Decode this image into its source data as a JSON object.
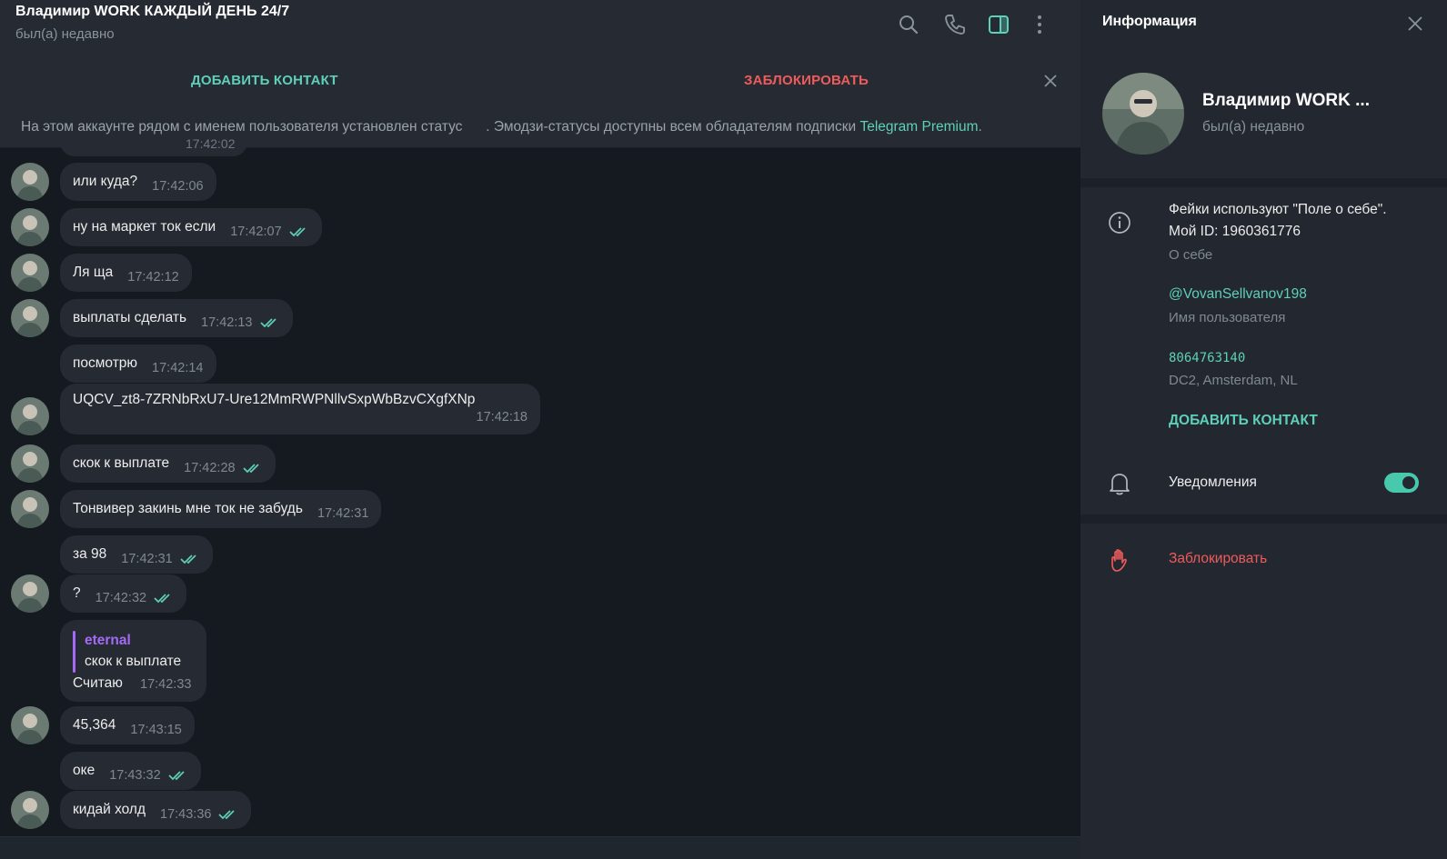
{
  "header": {
    "title": "Владимир WORK КАЖДЫЙ ДЕНЬ 24/7",
    "status": "был(а) недавно"
  },
  "action_bar": {
    "add_contact": "ДОБАВИТЬ КОНТАКТ",
    "block": "ЗАБЛОКИРОВАТЬ"
  },
  "notice": {
    "text_before": "На этом аккаунте рядом с именем пользователя установлен статус",
    "text_after": ". Эмодзи-статусы доступны всем обладателям подписки",
    "link": "Telegram Premium",
    "end": "."
  },
  "messages": [
    {
      "text": "или куда?",
      "time": "17:42:06"
    },
    {
      "text": "ну на маркет ток если",
      "time": "17:42:07"
    },
    {
      "text": "Ля ща",
      "time": "17:42:12"
    },
    {
      "text": "выплаты сделать",
      "time": "17:42:13"
    },
    {
      "text": "посмотрю",
      "time": "17:42:14"
    },
    {
      "text": "UQCV_zt8-7ZRNbRxU7-Ure12MmRWPNllvSxpWbBzvCXgfXNp",
      "time": "17:42:18"
    },
    {
      "text": "скок к выплате",
      "time": "17:42:28"
    },
    {
      "text": "Тонвивер закинь мне ток не забудь",
      "time": "17:42:31"
    },
    {
      "text": "за 98",
      "time": "17:42:31"
    },
    {
      "text": "?",
      "time": "17:42:32"
    },
    {
      "reply_name": "eternal",
      "reply_text": "скок к выплате",
      "text": "Считаю",
      "time": "17:42:33"
    },
    {
      "text": "45,364",
      "time": "17:43:15"
    },
    {
      "text": "оке",
      "time": "17:43:32"
    },
    {
      "text": "кидай холд",
      "time": "17:43:36"
    }
  ],
  "cut_message_time": "17:42:02",
  "panel": {
    "title": "Информация",
    "name": "Владимир WORK ...",
    "status": "был(а) недавно",
    "bio_line1": "Фейки используют \"Поле о себе\".",
    "bio_line2": "Мой ID: 1960361776",
    "bio_label": "О себе",
    "username": "@VovanSellvanov198",
    "username_label": "Имя пользователя",
    "id": "8064763140",
    "dc": "DC2, Amsterdam, NL",
    "add_contact": "ДОБАВИТЬ КОНТАКТ",
    "notifications": "Уведомления",
    "notifications_on": true,
    "block": "Заблокировать"
  },
  "colors": {
    "accent": "#5ecfb8",
    "danger": "#ef5b5b",
    "reply": "#a56af5"
  }
}
